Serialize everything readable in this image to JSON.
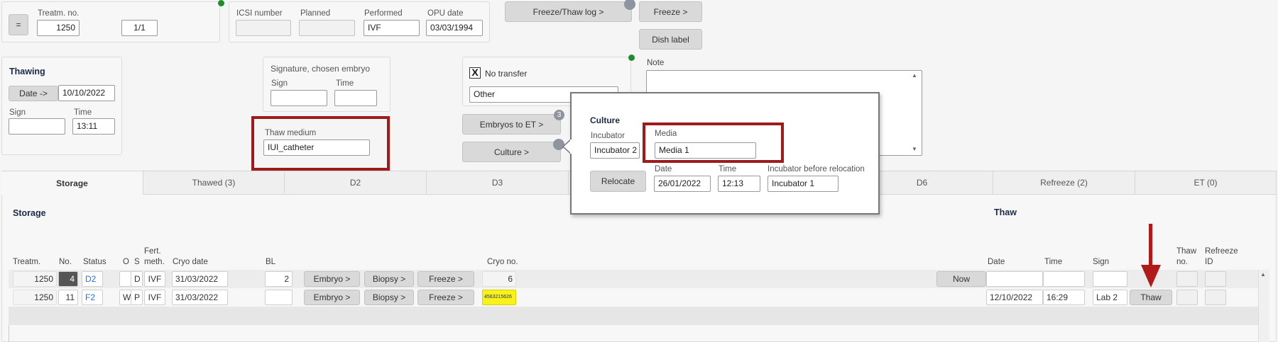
{
  "header": {
    "equals_button": "=",
    "treatment_no_label": "Treatm. no.",
    "treatment_no": "1250",
    "fraction": "1/1",
    "icsi_label": "ICSI number",
    "icsi_value": "",
    "planned_label": "Planned",
    "planned_value": "",
    "performed_label": "Performed",
    "performed_value": "IVF",
    "opu_label": "OPU date",
    "opu_value": "03/03/1994",
    "freeze_thaw_log": "Freeze/Thaw log >",
    "freeze": "Freeze >",
    "dish_label": "Dish label"
  },
  "thawing": {
    "title": "Thawing",
    "date_button": "Date ->",
    "date_value": "10/10/2022",
    "sign_label": "Sign",
    "sign_value": "",
    "time_label": "Time",
    "time_value": "13:11"
  },
  "signature": {
    "title": "Signature, chosen embryo",
    "sign_label": "Sign",
    "time_label": "Time",
    "sign_value": "",
    "time_value": ""
  },
  "thaw_medium": {
    "label": "Thaw medium",
    "value": "IUI_catheter"
  },
  "transfer": {
    "no_transfer_label": "No transfer",
    "checkbox_mark": "X",
    "reason_value": "Other",
    "embryos_to_et": "Embryos to ET >",
    "embryos_badge": "3",
    "culture": "Culture >"
  },
  "note": {
    "label": "Note",
    "value": "",
    "scroll_up": "▲",
    "scroll_down": "▼"
  },
  "popup": {
    "title": "Culture",
    "incubator_label": "Incubator",
    "incubator_value": "Incubator 2",
    "media_label": "Media",
    "media_value": "Media 1",
    "relocate": "Relocate",
    "date_label": "Date",
    "date_value": "26/01/2022",
    "time_label": "Time",
    "time_value": "12:13",
    "before_label": "Incubator before relocation",
    "before_value": "Incubator 1"
  },
  "tabs": [
    "Storage",
    "Thawed (3)",
    "D2",
    "D3",
    "D6",
    "Refreeze (2)",
    "ET (0)"
  ],
  "storage": {
    "section_title": "Storage",
    "thaw_section_title": "Thaw",
    "columns": {
      "treatm": "Treatm.",
      "no": "No.",
      "status": "Status",
      "o": "O",
      "s": "S",
      "fert1": "Fert.",
      "fert2": "meth.",
      "cryo_date": "Cryo date",
      "bl": "BL",
      "cryo_no": "Cryo no.",
      "date": "Date",
      "time": "Time",
      "sign": "Sign",
      "thaw_no1": "Thaw",
      "thaw_no2": "no.",
      "refreeze1": "Refreeze",
      "refreeze2": "ID"
    },
    "rows": [
      {
        "treatm": "1250",
        "no": "4",
        "status": "D2",
        "o": "",
        "s": "D",
        "meth": "IVF",
        "cryo_date": "31/03/2022",
        "bl": "2",
        "embryo": "Embryo >",
        "biopsy": "Biopsy >",
        "freeze": "Freeze >",
        "cryo_no": "6",
        "now": "Now",
        "date": "",
        "time": "",
        "sign": ""
      },
      {
        "treatm": "1250",
        "no": "11",
        "status": "F2",
        "o": "W",
        "s": "P",
        "meth": "IVF",
        "cryo_date": "31/03/2022",
        "bl": "",
        "embryo": "Embryo >",
        "biopsy": "Biopsy >",
        "freeze": "Freeze >",
        "cryo_no": "4563215626",
        "date": "12/10/2022",
        "time": "16:29",
        "sign": "Lab 2",
        "thaw": "Thaw"
      }
    ],
    "scroll_up": "▲"
  },
  "colors": {
    "highlight_red": "#9e1b1b",
    "status_green": "#1e8c2a",
    "link_blue": "#2d6fd6",
    "cryo_yellow": "#f7f21a"
  }
}
